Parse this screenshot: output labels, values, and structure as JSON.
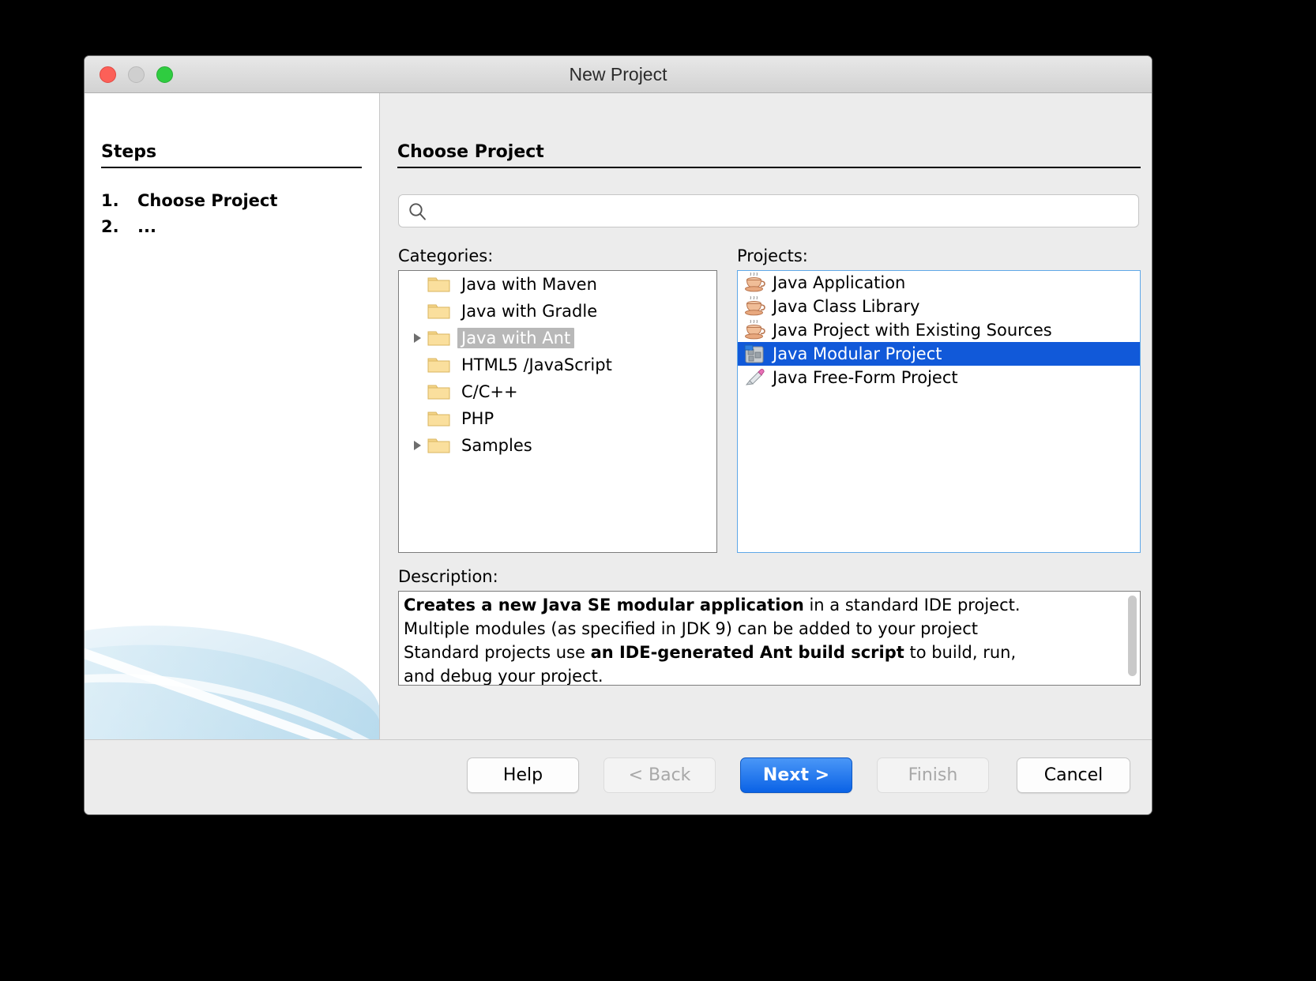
{
  "window": {
    "title": "New Project",
    "traffic_lights": [
      "close",
      "minimize",
      "maximize"
    ]
  },
  "steps_pane": {
    "heading": "Steps",
    "items": [
      {
        "num": "1.",
        "label": "Choose Project",
        "active": true
      },
      {
        "num": "2.",
        "label": "...",
        "active": false
      }
    ]
  },
  "main": {
    "title": "Choose Project",
    "search": {
      "value": "",
      "placeholder": "",
      "icon": "search-icon"
    },
    "categories": {
      "label": "Categories:",
      "items": [
        {
          "label": "Java with Maven",
          "expandable": false,
          "selected": false,
          "icon": "folder-icon"
        },
        {
          "label": "Java with Gradle",
          "expandable": false,
          "selected": false,
          "icon": "folder-icon"
        },
        {
          "label": "Java with Ant",
          "expandable": true,
          "selected": true,
          "icon": "folder-icon"
        },
        {
          "label": "HTML5 /JavaScript",
          "expandable": false,
          "selected": false,
          "icon": "folder-icon"
        },
        {
          "label": "C/C++",
          "expandable": false,
          "selected": false,
          "icon": "folder-icon"
        },
        {
          "label": "PHP",
          "expandable": false,
          "selected": false,
          "icon": "folder-icon"
        },
        {
          "label": "Samples",
          "expandable": true,
          "selected": false,
          "icon": "folder-icon"
        }
      ]
    },
    "projects": {
      "label": "Projects:",
      "items": [
        {
          "label": "Java Application",
          "selected": false,
          "icon": "java-coffee-cup-icon"
        },
        {
          "label": "Java Class Library",
          "selected": false,
          "icon": "java-coffee-cup-icon"
        },
        {
          "label": "Java Project with Existing Sources",
          "selected": false,
          "icon": "java-coffee-cup-icon"
        },
        {
          "label": "Java Modular Project",
          "selected": true,
          "icon": "java-modular-icon"
        },
        {
          "label": "Java Free-Form Project",
          "selected": false,
          "icon": "java-freeform-icon"
        }
      ]
    },
    "description": {
      "label": "Description:",
      "lines": [
        [
          {
            "text": "Creates a new Java SE modular application",
            "bold": true
          },
          {
            "text": " in a standard IDE project.",
            "bold": false
          }
        ],
        [
          {
            "text": "Multiple modules (as specified in JDK 9) can be added to your project",
            "bold": false
          }
        ],
        [
          {
            "text": "Standard projects use ",
            "bold": false
          },
          {
            "text": "an IDE-generated Ant build script",
            "bold": true
          },
          {
            "text": " to build, run,",
            "bold": false
          }
        ],
        [
          {
            "text": "and debug your project.",
            "bold": false
          }
        ]
      ],
      "scrollbar_visible": true
    }
  },
  "footer": {
    "buttons": [
      {
        "id": "help",
        "label": "Help",
        "state": "enabled"
      },
      {
        "id": "back",
        "label": "< Back",
        "state": "disabled"
      },
      {
        "id": "next",
        "label": "Next >",
        "state": "primary"
      },
      {
        "id": "finish",
        "label": "Finish",
        "state": "disabled"
      },
      {
        "id": "cancel",
        "label": "Cancel",
        "state": "enabled"
      }
    ]
  },
  "colors": {
    "selection_blue": "#1159d9",
    "primary_button": "#0a62e6",
    "inactive_selection": "#b8b8b8",
    "focus_border": "#5fa8e8",
    "window_bg": "#ececec",
    "watermark": "#cfe6f2"
  }
}
